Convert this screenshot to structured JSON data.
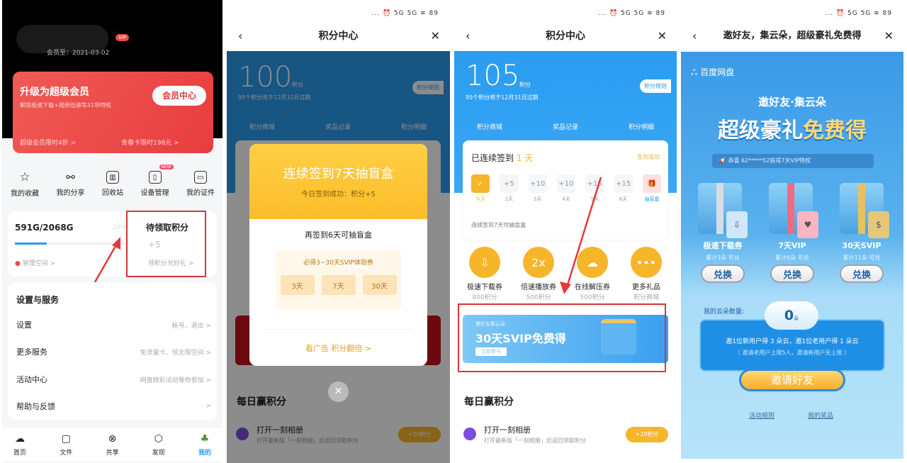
{
  "colors": {
    "red": "#e94a48",
    "blue": "#2b9bef",
    "gold": "#f7b52a",
    "annotation": "#d9353a"
  },
  "p1": {
    "member_until": "会员至：2021-03-02",
    "vip_badge": "VIP",
    "promo": {
      "title": "升级为超级会员",
      "subtitle": "解锁极速下载+视频倍速等31项特权",
      "button": "会员中心",
      "link1": "超级会员限时4折 >",
      "link2": "青春卡限时198元 >"
    },
    "shortcuts": [
      {
        "label": "我的收藏",
        "icon": "star-icon"
      },
      {
        "label": "我的分享",
        "icon": "share-icon"
      },
      {
        "label": "回收站",
        "icon": "trash-icon"
      },
      {
        "label": "设备管理",
        "icon": "device-icon",
        "badge": "NEW"
      },
      {
        "label": "我的证件",
        "icon": "id-card-icon"
      }
    ],
    "storage": {
      "used": "591G/2068G",
      "percent_label": "29%",
      "percent": 29,
      "manage": "管理空间 >"
    },
    "points": {
      "title": "待领取积分",
      "value": "+5",
      "link": "领积分兑好礼 >"
    },
    "settings": {
      "title": "设置与服务",
      "items": [
        {
          "label": "设置",
          "hint": "帐号、退出 >"
        },
        {
          "label": "更多服务",
          "hint": "免流量卡、领无限空间 >"
        },
        {
          "label": "活动中心",
          "hint": "网盘精彩活动等你参加 >"
        },
        {
          "label": "帮助与反馈",
          "hint": ">"
        }
      ]
    },
    "nav": [
      {
        "label": "首页",
        "icon": "cloud-icon"
      },
      {
        "label": "文件",
        "icon": "folder-icon"
      },
      {
        "label": "共享",
        "icon": "share-circle-icon"
      },
      {
        "label": "发现",
        "icon": "discover-icon"
      },
      {
        "label": "我的",
        "icon": "profile-icon",
        "active": true
      }
    ]
  },
  "status": "... ⏰ 5G 5G ≋ 89",
  "points_center": {
    "title": "积分中心",
    "unit": "积分",
    "expire": "95个积分将于12月31日过期",
    "rules": "积分规则",
    "tabs": [
      "积分商城",
      "奖品记录",
      "积分明细"
    ],
    "daily_title": "每日赢积分",
    "task": {
      "title": "打开一刻相册",
      "desc": "打开最新版「一刻相册」后返回领取积分",
      "reward": "+20积分"
    }
  },
  "p2": {
    "points": "100",
    "modal": {
      "title": "连续签到7天抽盲盒",
      "subtitle": "今日签到成功：积分+5",
      "remain": "再签到6天可抽盲盒",
      "guarantee": "必得3~30天SVIP体验券",
      "tickets": [
        "3天",
        "7天",
        "30天"
      ],
      "ad_link": "看广告 积分翻倍 >"
    }
  },
  "p3": {
    "points": "105",
    "checkin": {
      "label": "已连续签到",
      "days": "1 天",
      "status": "签到成功",
      "note": "连续签到7天可抽盲盒",
      "days_list": [
        {
          "value": "✓",
          "label": "今天"
        },
        {
          "value": "+5",
          "label": "2天"
        },
        {
          "value": "+10",
          "label": "3天"
        },
        {
          "value": "+10",
          "label": "4天"
        },
        {
          "value": "+15",
          "label": "5天"
        },
        {
          "value": "+15",
          "label": "6天"
        },
        {
          "value": "🎁",
          "label": "抽盲盒"
        }
      ]
    },
    "rewards": [
      {
        "name": "极速下载券",
        "cost": "800积分",
        "icon": "download-icon"
      },
      {
        "name": "倍速播放券",
        "cost": "500积分",
        "icon": "speed-icon"
      },
      {
        "name": "在线解压券",
        "cost": "500积分",
        "icon": "unzip-cloud-icon"
      },
      {
        "name": "更多礼品",
        "cost": "积分商城",
        "icon": "more-icon"
      }
    ],
    "banner": {
      "small": "邀好友集云朵",
      "big": "30天SVIP免费得",
      "button": "立即参与"
    }
  },
  "p4": {
    "title": "邀好友，集云朵，超级豪礼免费得",
    "brand": "百度网盘",
    "heading": "邀好友·集云朵",
    "headline_a": "超级豪礼",
    "headline_b": "免费得",
    "ticker": "恭喜 62*****52获得7天VIP特权",
    "prizes": [
      {
        "name": "极速下载券",
        "need": "累计3朵 可兑",
        "button": "兑换"
      },
      {
        "name": "7天VIP",
        "need": "累计6朵 可兑",
        "button": "兑换"
      },
      {
        "name": "30天SVIP",
        "need": "累计11朵 可兑",
        "button": "兑换"
      }
    ],
    "my_clouds_label": "我的云朵数量:",
    "clouds": "0",
    "clouds_unit": "朵",
    "rule": "邀1位新用户得 3 朵云，邀1位老用户得 1 朵云",
    "rule_note": "（ 邀请老用户上限5人，邀请新用户无上限 ）",
    "invite": "邀请好友",
    "links": [
      "活动规则",
      "我的奖品"
    ]
  }
}
